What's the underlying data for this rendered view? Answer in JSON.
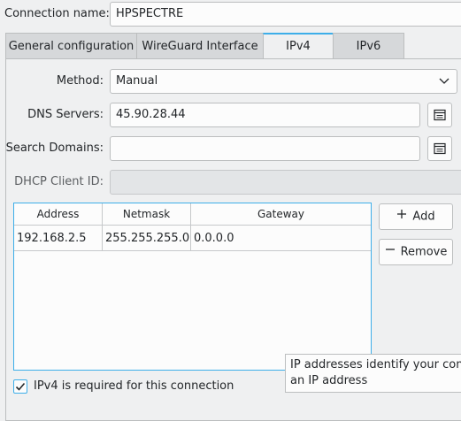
{
  "connection_name": {
    "label": "Connection name:",
    "value": "HPSPECTRE"
  },
  "tabs": [
    {
      "label": "General configuration"
    },
    {
      "label": "WireGuard Interface"
    },
    {
      "label": "IPv4"
    },
    {
      "label": "IPv6"
    }
  ],
  "active_tab": "IPv4",
  "method": {
    "label": "Method:",
    "value": "Manual"
  },
  "dns_servers": {
    "label": "DNS Servers:",
    "value": "45.90.28.44"
  },
  "search_domains": {
    "label": "Search Domains:",
    "value": ""
  },
  "dhcp_client_id": {
    "label": "DHCP Client ID:",
    "value": ""
  },
  "addresses": {
    "columns": [
      "Address",
      "Netmask",
      "Gateway"
    ],
    "rows": [
      [
        "192.168.2.5",
        "255.255.255.0",
        "0.0.0.0"
      ]
    ]
  },
  "buttons": {
    "add": "Add",
    "remove": "Remove"
  },
  "icons": {
    "add": "plus-icon",
    "remove": "minus-icon",
    "edit_list": "list-edit-icon",
    "dropdown": "chevron-down-icon",
    "check": "checkmark-icon"
  },
  "ipv4_required": {
    "label": "IPv4 is required for this connection",
    "checked": true
  },
  "tooltip": {
    "line1": "IP addresses identify your comp",
    "line2": "an IP address"
  },
  "colors": {
    "accent": "#3daee9",
    "window_bg": "#eff0f1",
    "text": "#232629"
  }
}
